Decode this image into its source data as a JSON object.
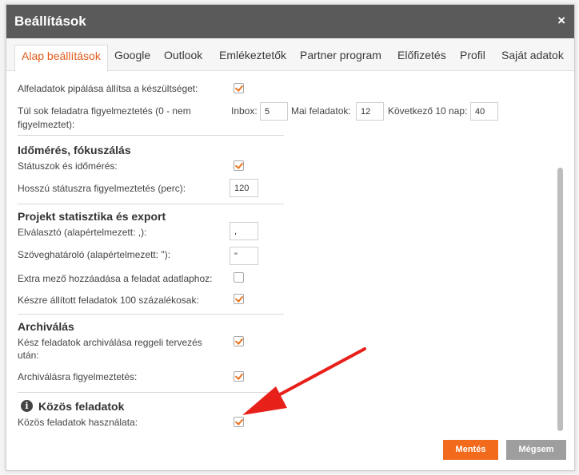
{
  "dialog": {
    "title": "Beállítások",
    "close_icon": "×"
  },
  "tabs": [
    {
      "label": "Alap beállítások"
    },
    {
      "label": "Google"
    },
    {
      "label": "Outlook"
    },
    {
      "label": "Emlékeztetők"
    },
    {
      "label": "Partner program"
    },
    {
      "label": "Előfizetés"
    },
    {
      "label": "Profil"
    },
    {
      "label": "Saját adatok"
    }
  ],
  "settings": {
    "subtask_checkbox_label": "Alfeladatok pipálása állítsa a készültséget:",
    "too_many_warning_label": "Túl sok feladatra figyelmeztetés (0 - nem",
    "too_many_warning_label2": "figyelmeztet):",
    "inbox_label": "Inbox:",
    "inbox_value": "5",
    "today_label": "Mai feladatok:",
    "today_value": "12",
    "next10_label": "Következő 10 nap:",
    "next10_value": "40"
  },
  "time_tracking": {
    "heading": "Időmérés, fókuszálás",
    "status_label": "Státuszok és időmérés:",
    "long_status_label": "Hosszú státuszra figyelmeztetés (perc):",
    "long_status_value": "120"
  },
  "project_export": {
    "heading": "Projekt statisztika és export",
    "separator_label": "Elválasztó (alapértelmezett: ,):",
    "separator_value": ",",
    "text_qualifier_label": "Szöveghatároló (alapértelmezett: \"):",
    "text_qualifier_value": "\"",
    "extra_field_label": "Extra mező hozzáadása a feladat adatlaphoz:",
    "done_100_label": "Készre állított feladatok 100 százalékosak:"
  },
  "archive": {
    "heading": "Archiválás",
    "morning_label": "Kész feladatok archiválása reggeli tervezés",
    "morning_label2": "után:",
    "warning_label": "Archiválásra figyelmeztetés:"
  },
  "shared_tasks": {
    "heading": "Közös feladatok",
    "info_icon": "i",
    "use_label": "Közös feladatok használata:"
  },
  "buttons": {
    "save": "Mentés",
    "cancel": "Mégsem"
  },
  "colors": {
    "accent": "#f26a1b",
    "titlebar": "#5a5a5a",
    "arrow": "#e8201a",
    "check": "#e8731f"
  }
}
